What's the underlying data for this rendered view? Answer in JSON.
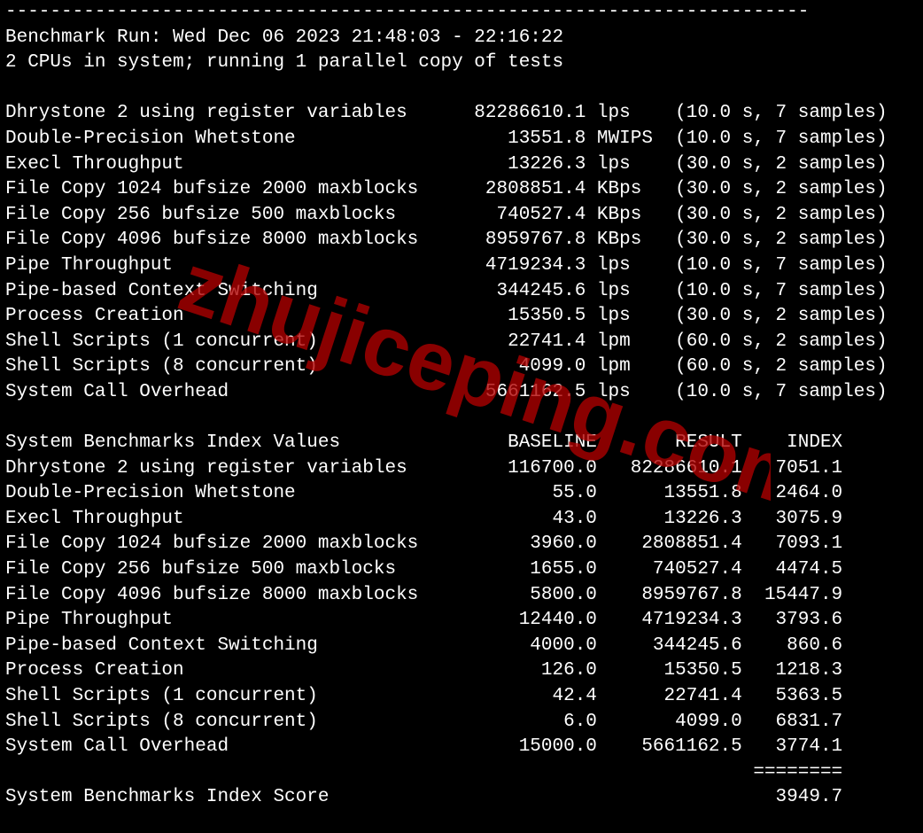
{
  "divider": "------------------------------------------------------------------------",
  "run1": "Benchmark Run: Wed Dec 06 2023 21:48:03 - 22:16:22",
  "run2": "2 CPUs in system; running 1 parallel copy of tests",
  "benchmarks": [
    {
      "name": "Dhrystone 2 using register variables",
      "value": "82286610.1",
      "unit": "lps",
      "timing": "(10.0 s, 7 samples)"
    },
    {
      "name": "Double-Precision Whetstone",
      "value": "13551.8",
      "unit": "MWIPS",
      "timing": "(10.0 s, 7 samples)"
    },
    {
      "name": "Execl Throughput",
      "value": "13226.3",
      "unit": "lps",
      "timing": "(30.0 s, 2 samples)"
    },
    {
      "name": "File Copy 1024 bufsize 2000 maxblocks",
      "value": "2808851.4",
      "unit": "KBps",
      "timing": "(30.0 s, 2 samples)"
    },
    {
      "name": "File Copy 256 bufsize 500 maxblocks",
      "value": "740527.4",
      "unit": "KBps",
      "timing": "(30.0 s, 2 samples)"
    },
    {
      "name": "File Copy 4096 bufsize 8000 maxblocks",
      "value": "8959767.8",
      "unit": "KBps",
      "timing": "(30.0 s, 2 samples)"
    },
    {
      "name": "Pipe Throughput",
      "value": "4719234.3",
      "unit": "lps",
      "timing": "(10.0 s, 7 samples)"
    },
    {
      "name": "Pipe-based Context Switching",
      "value": "344245.6",
      "unit": "lps",
      "timing": "(10.0 s, 7 samples)"
    },
    {
      "name": "Process Creation",
      "value": "15350.5",
      "unit": "lps",
      "timing": "(30.0 s, 2 samples)"
    },
    {
      "name": "Shell Scripts (1 concurrent)",
      "value": "22741.4",
      "unit": "lpm",
      "timing": "(60.0 s, 2 samples)"
    },
    {
      "name": "Shell Scripts (8 concurrent)",
      "value": "4099.0",
      "unit": "lpm",
      "timing": "(60.0 s, 2 samples)"
    },
    {
      "name": "System Call Overhead",
      "value": "5661162.5",
      "unit": "lps",
      "timing": "(10.0 s, 7 samples)"
    }
  ],
  "indexHeader": {
    "title": "System Benchmarks Index Values",
    "c1": "BASELINE",
    "c2": "RESULT",
    "c3": "INDEX"
  },
  "indexRows": [
    {
      "name": "Dhrystone 2 using register variables",
      "baseline": "116700.0",
      "result": "82286610.1",
      "index": "7051.1"
    },
    {
      "name": "Double-Precision Whetstone",
      "baseline": "55.0",
      "result": "13551.8",
      "index": "2464.0"
    },
    {
      "name": "Execl Throughput",
      "baseline": "43.0",
      "result": "13226.3",
      "index": "3075.9"
    },
    {
      "name": "File Copy 1024 bufsize 2000 maxblocks",
      "baseline": "3960.0",
      "result": "2808851.4",
      "index": "7093.1"
    },
    {
      "name": "File Copy 256 bufsize 500 maxblocks",
      "baseline": "1655.0",
      "result": "740527.4",
      "index": "4474.5"
    },
    {
      "name": "File Copy 4096 bufsize 8000 maxblocks",
      "baseline": "5800.0",
      "result": "8959767.8",
      "index": "15447.9"
    },
    {
      "name": "Pipe Throughput",
      "baseline": "12440.0",
      "result": "4719234.3",
      "index": "3793.6"
    },
    {
      "name": "Pipe-based Context Switching",
      "baseline": "4000.0",
      "result": "344245.6",
      "index": "860.6"
    },
    {
      "name": "Process Creation",
      "baseline": "126.0",
      "result": "15350.5",
      "index": "1218.3"
    },
    {
      "name": "Shell Scripts (1 concurrent)",
      "baseline": "42.4",
      "result": "22741.4",
      "index": "5363.5"
    },
    {
      "name": "Shell Scripts (8 concurrent)",
      "baseline": "6.0",
      "result": "4099.0",
      "index": "6831.7"
    },
    {
      "name": "System Call Overhead",
      "baseline": "15000.0",
      "result": "5661162.5",
      "index": "3774.1"
    }
  ],
  "scoreDiv": "                                                                   ========",
  "scoreLine": {
    "label": "System Benchmarks Index Score",
    "value": "3949.7"
  },
  "watermarkText": "zhujiceping.com",
  "watermarkColor": "#b00000"
}
